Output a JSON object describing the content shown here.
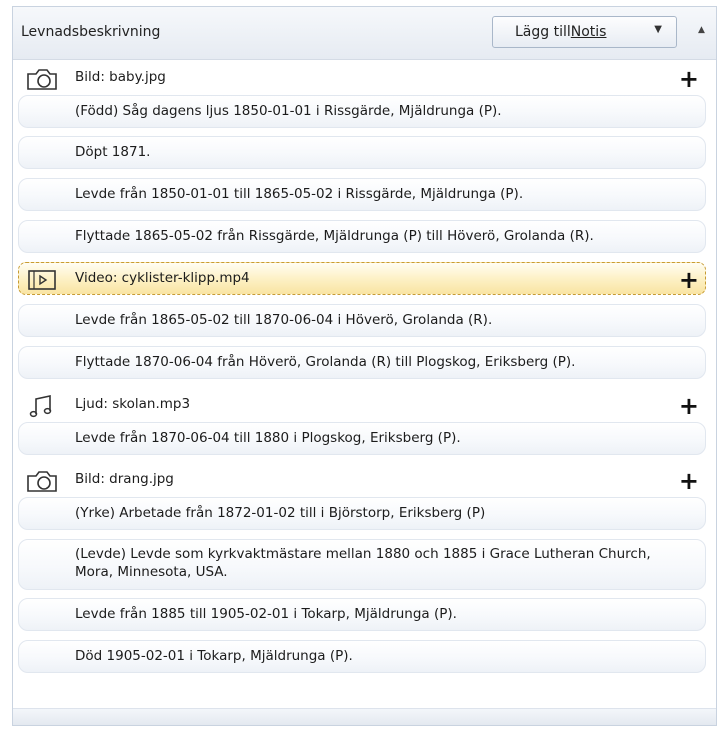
{
  "header": {
    "title": "Levnadsbeskrivning",
    "add_note_prefix": "Lägg till ",
    "add_note_underlined": "Notis"
  },
  "rows": [
    {
      "kind": "media",
      "icon": "camera-icon",
      "text": "Bild: baby.jpg"
    },
    {
      "kind": "event",
      "text": "(Född) Såg dagens ljus 1850-01-01 i Rissgärde, Mjäldrunga (P)."
    },
    {
      "kind": "event",
      "text": "Döpt 1871."
    },
    {
      "kind": "event",
      "text": "Levde från 1850-01-01 till 1865-05-02 i Rissgärde, Mjäldrunga (P)."
    },
    {
      "kind": "event",
      "text": "Flyttade 1865-05-02 från Rissgärde, Mjäldrunga (P) till Höverö, Grolanda (R)."
    },
    {
      "kind": "media",
      "icon": "video-icon",
      "text": "Video: cyklister-klipp.mp4",
      "selected": true
    },
    {
      "kind": "event",
      "text": "Levde från 1865-05-02 till 1870-06-04 i Höverö, Grolanda (R)."
    },
    {
      "kind": "event",
      "text": "Flyttade 1870-06-04 från Höverö, Grolanda (R) till Plogskog, Eriksberg (P)."
    },
    {
      "kind": "media",
      "icon": "music-note-icon",
      "text": "Ljud: skolan.mp3"
    },
    {
      "kind": "event",
      "text": "Levde från 1870-06-04 till 1880 i Plogskog, Eriksberg (P)."
    },
    {
      "kind": "media",
      "icon": "camera-icon",
      "text": "Bild: drang.jpg"
    },
    {
      "kind": "event",
      "text": "(Yrke) Arbetade från 1872-01-02 till  i Björstorp, Eriksberg (P)"
    },
    {
      "kind": "event",
      "text": "(Levde) Levde som kyrkvaktmästare mellan 1880 och 1885 i Grace Lutheran Church, Mora, Minnesota, USA."
    },
    {
      "kind": "event",
      "text": "Levde från 1885 till 1905-02-01 i Tokarp, Mjäldrunga (P)."
    },
    {
      "kind": "event",
      "text": "Död 1905-02-01 i Tokarp, Mjäldrunga (P)."
    }
  ]
}
